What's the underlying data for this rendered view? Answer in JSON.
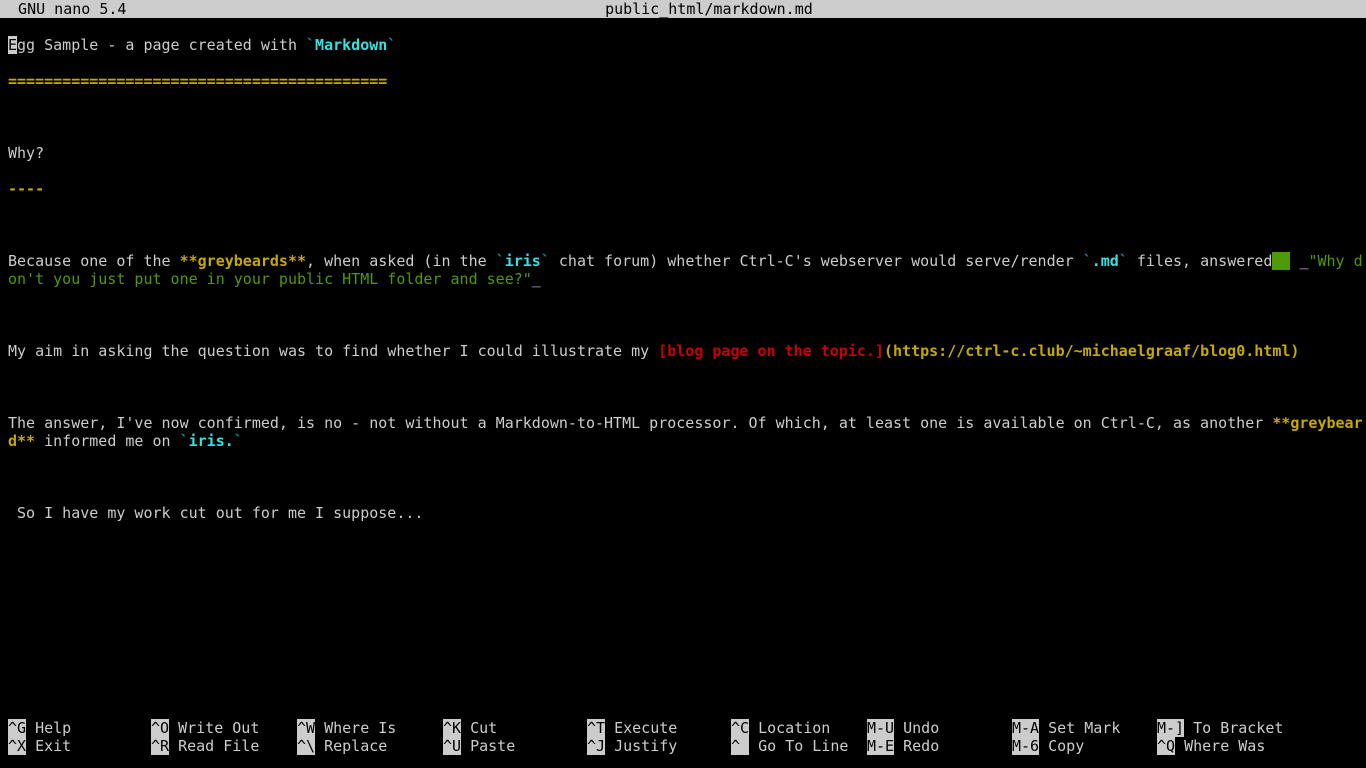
{
  "titlebar": {
    "app": "GNU nano 5.4",
    "file": "public_html/markdown.md"
  },
  "content": {
    "line1": {
      "cursor": "E",
      "rest": "gg Sample - a page created with ",
      "tick1": "`",
      "md": "Markdown",
      "tick2": "`"
    },
    "line2": "==========================================",
    "line3": "",
    "line4": "Why?",
    "line5": "----",
    "line6": "",
    "line7": {
      "a": "Because one of the ",
      "b": "**greybeards**",
      "c": ", when asked (in the ",
      "t1": "`",
      "d": "iris",
      "t2": "`",
      "e": " chat forum) whether Ctrl-C's webserver would serve/render ",
      "t3": "`",
      "f": ".md",
      "t4": "`",
      "g": " files, answered"
    },
    "line8": {
      "u1": "_",
      "q": "\"Why don't you just put one in your public HTML folder and see?\"",
      "u2": "_"
    },
    "line9": "",
    "line10": {
      "a": "My aim in asking the question was to find whether I could illustrate my ",
      "b": "[blog page on the topic.]",
      "c": "(https://ctrl-c.club/~michaelgraaf/blog0.html)"
    },
    "line11": "",
    "line12": {
      "a": "The answer, I've now confirmed, is no - not without a Markdown-to-HTML processor. Of which, at least one is available on Ctrl-C, as another ",
      "b": "**greybeard**",
      "c": " informed me on ",
      "t1": "`",
      "d": "iris.",
      "t2": "`"
    },
    "line13": "",
    "line14": " So I have my work cut out for me I suppose...",
    "line15": ""
  },
  "help": {
    "row1": [
      {
        "key": "^G",
        "label": " Help"
      },
      {
        "key": "^O",
        "label": " Write Out"
      },
      {
        "key": "^W",
        "label": " Where Is"
      },
      {
        "key": "^K",
        "label": " Cut"
      },
      {
        "key": "^T",
        "label": " Execute"
      },
      {
        "key": "^C",
        "label": " Location"
      },
      {
        "key": "M-U",
        "label": " Undo"
      },
      {
        "key": "M-A",
        "label": " Set Mark"
      },
      {
        "key": "M-]",
        "label": " To Bracket"
      }
    ],
    "row2": [
      {
        "key": "^X",
        "label": " Exit"
      },
      {
        "key": "^R",
        "label": " Read File"
      },
      {
        "key": "^\\",
        "label": " Replace"
      },
      {
        "key": "^U",
        "label": " Paste"
      },
      {
        "key": "^J",
        "label": " Justify"
      },
      {
        "key": "^ ",
        "label": " Go To Line"
      },
      {
        "key": "M-E",
        "label": " Redo"
      },
      {
        "key": "M-6",
        "label": " Copy"
      },
      {
        "key": "^Q",
        "label": " Where Was"
      }
    ]
  }
}
